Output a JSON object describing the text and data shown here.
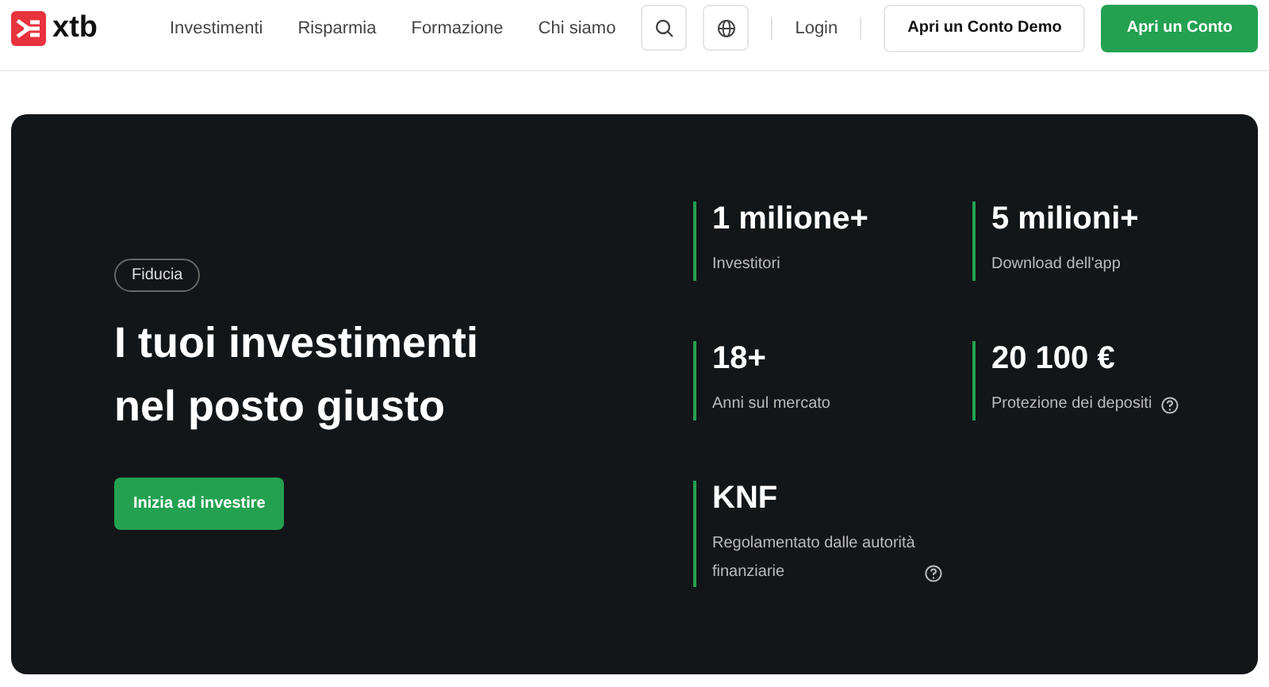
{
  "header": {
    "logo": "xtb",
    "nav": [
      "Investimenti",
      "Risparmia",
      "Formazione",
      "Chi siamo"
    ],
    "login": "Login",
    "demo_button": "Apri un Conto Demo",
    "cta_button": "Apri un Conto"
  },
  "hero": {
    "badge": "Fiducia",
    "title": "I tuoi investimenti nel posto giusto",
    "button": "Inizia ad investire",
    "stats": [
      {
        "value": "1 milione+",
        "label": "Investitori",
        "info": false
      },
      {
        "value": "5 milioni+",
        "label": "Download dell'app",
        "info": false
      },
      {
        "value": "18+",
        "label": "Anni sul mercato",
        "info": false
      },
      {
        "value": "20 100 €",
        "label": "Protezione dei depositi",
        "info": true
      },
      {
        "value": "KNF",
        "label": "Regolamentato dalle autorità finanziarie",
        "info": true
      }
    ]
  }
}
